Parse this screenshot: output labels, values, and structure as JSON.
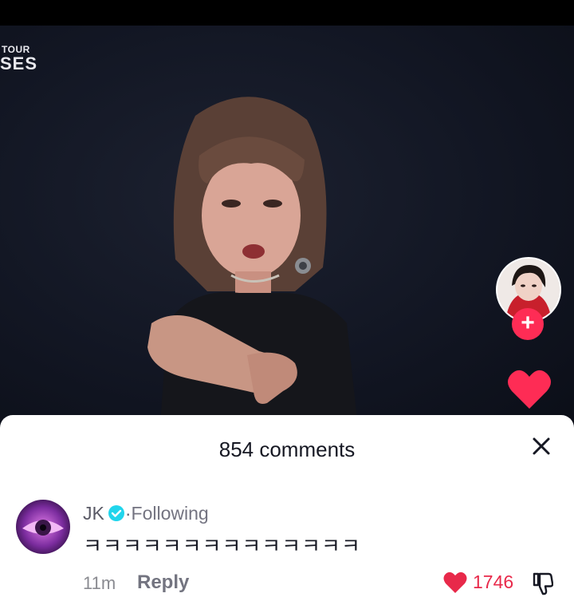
{
  "video": {
    "overlay_line1": "TOUR",
    "overlay_line2": "SES"
  },
  "sidebar": {
    "follow_symbol": "+",
    "icons": [
      "creator-avatar",
      "plus-icon",
      "heart-icon"
    ]
  },
  "comments": {
    "title": "854 comments",
    "close_icon": "close-icon",
    "items": [
      {
        "username": "JK",
        "verified": true,
        "separator": "·",
        "relation": "Following",
        "text": "ㅋㅋㅋㅋㅋㅋㅋㅋㅋㅋㅋㅋㅋㅋ",
        "time": "11m",
        "reply_label": "Reply",
        "likes": "1746"
      }
    ]
  },
  "colors": {
    "accent": "#fe2c55",
    "like_red": "#e8294a",
    "verified_blue": "#20d5ec"
  }
}
